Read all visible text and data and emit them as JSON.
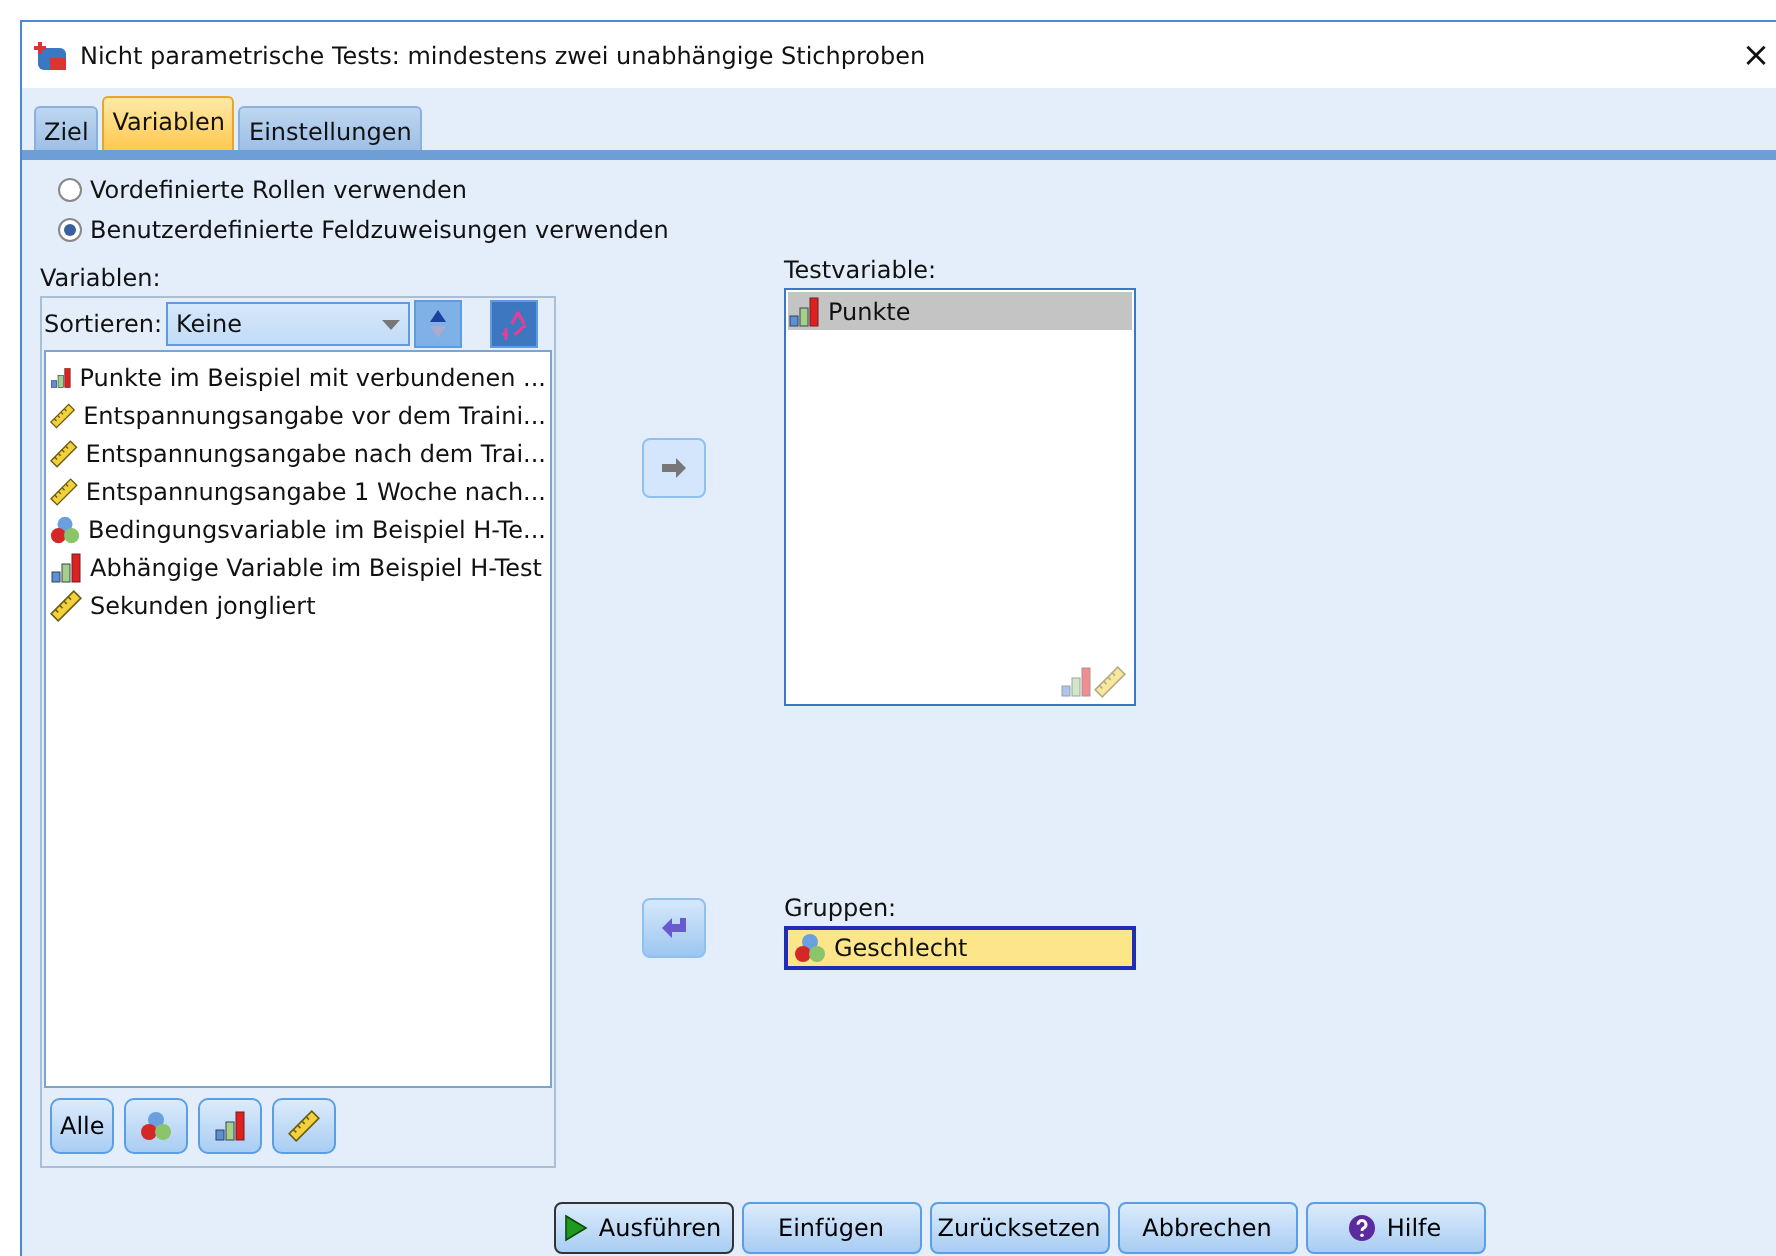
{
  "window": {
    "title": "Nicht parametrische Tests: mindestens zwei unabhängige Stichproben",
    "close": "×"
  },
  "tabs": [
    {
      "label": "Ziel",
      "selected": false
    },
    {
      "label": "Variablen",
      "selected": true
    },
    {
      "label": "Einstellungen",
      "selected": false
    }
  ],
  "roles": [
    {
      "label": "Vordefinierte Rollen verwenden",
      "selected": false
    },
    {
      "label": "Benutzerdefinierte Feldzuweisungen verwenden",
      "selected": true
    }
  ],
  "variables": {
    "label": "Variablen:",
    "sort_label": "Sortieren:",
    "sort_value": "Keine",
    "items": [
      {
        "name": "Punkte im Beispiel mit verbundenen ...",
        "kind": "ordinal"
      },
      {
        "name": "Entspannungsangabe vor dem Traini...",
        "kind": "scale"
      },
      {
        "name": "Entspannungsangabe nach dem Trai...",
        "kind": "scale"
      },
      {
        "name": "Entspannungsangabe 1 Woche nach...",
        "kind": "scale"
      },
      {
        "name": "Bedingungsvariable im Beispiel H-Te...",
        "kind": "nominal"
      },
      {
        "name": "Abhängige Variable im Beispiel H-Test",
        "kind": "ordinal"
      },
      {
        "name": "Sekunden jongliert",
        "kind": "scale"
      }
    ],
    "filter_all": "Alle"
  },
  "test_variables": {
    "label": "Testvariable:",
    "items": [
      {
        "name": "Punkte",
        "kind": "ordinal",
        "selected": true
      }
    ]
  },
  "groups": {
    "label": "Gruppen:",
    "value": "Geschlecht",
    "kind": "nominal"
  },
  "buttons": [
    {
      "label": "Ausführen",
      "kind": "run"
    },
    {
      "label": "Einfügen",
      "kind": "plain"
    },
    {
      "label": "Zurücksetzen",
      "kind": "plain"
    },
    {
      "label": "Abbrechen",
      "kind": "plain"
    },
    {
      "label": "Hilfe",
      "kind": "help"
    }
  ]
}
